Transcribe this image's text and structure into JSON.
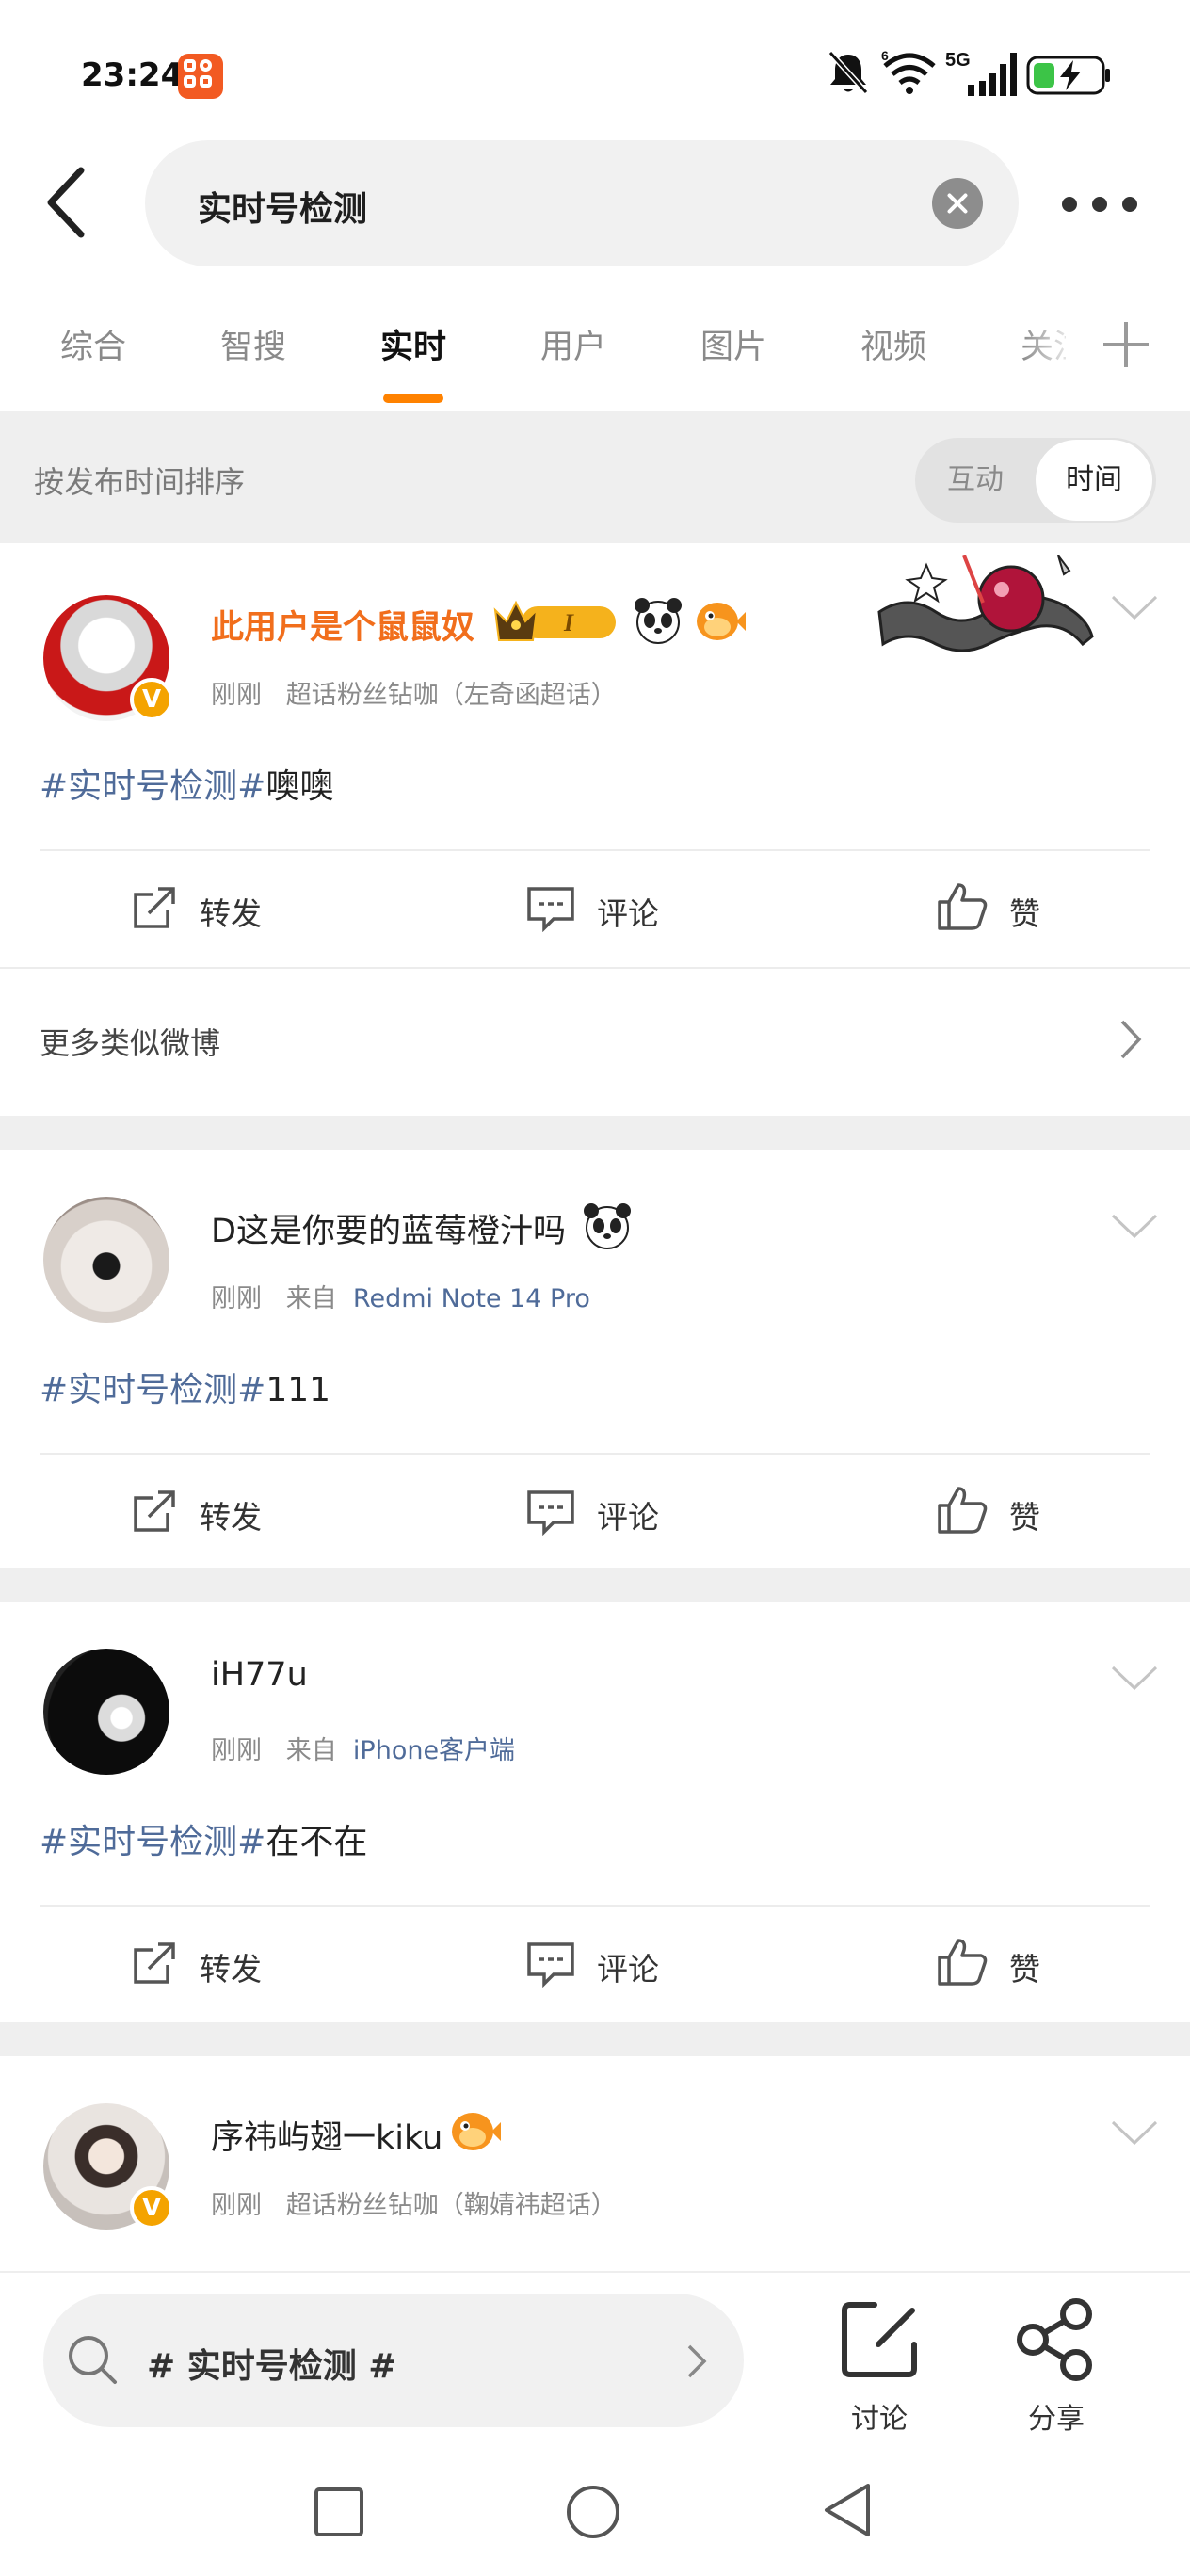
{
  "status_bar": {
    "time": "23:24",
    "icons": [
      "kuaishou-app-icon",
      "mute-bell-icon",
      "wifi-icon",
      "5g-signal-icon",
      "battery-charging-icon"
    ],
    "wifi_badge": "6",
    "network": "5G"
  },
  "header": {
    "search_query": "实时号检测",
    "back_icon": "back-arrow-icon",
    "clear_icon": "clear-icon",
    "more_icon": "more-dots-icon"
  },
  "tabs": [
    {
      "label": "综合",
      "active": false
    },
    {
      "label": "智搜",
      "active": false
    },
    {
      "label": "实时",
      "active": true
    },
    {
      "label": "用户",
      "active": false
    },
    {
      "label": "图片",
      "active": false
    },
    {
      "label": "视频",
      "active": false
    },
    {
      "label": "关注",
      "active": false
    }
  ],
  "accent_color": "#ff8200",
  "link_color": "#4f6b99",
  "sort": {
    "label": "按发布时间排序",
    "options": [
      "互动",
      "时间"
    ],
    "selected": "时间"
  },
  "posts": [
    {
      "username": "此用户是个鼠鼠奴",
      "vip_level": "I",
      "time": "刚刚",
      "source": "超话粉丝钻咖（左奇函超话）",
      "source_prefix": "",
      "hashtag": "#实时号检测#",
      "text": "噢噢",
      "verified": true
    },
    {
      "username": "D这是你要的蓝莓橙汁吗",
      "time": "刚刚",
      "source_prefix": "来自",
      "source": "Redmi Note 14 Pro",
      "hashtag": "#实时号检测#",
      "text": "111",
      "verified": false
    },
    {
      "username": "iH77u",
      "time": "刚刚",
      "source_prefix": "来自",
      "source": "iPhone客户端",
      "hashtag": "#实时号检测#",
      "text": "在不在",
      "verified": false
    },
    {
      "username": "序祎屿翅一kiku",
      "time": "刚刚",
      "source_prefix": "",
      "source": "超话粉丝钻咖（鞠婧祎超话）",
      "verified": true
    }
  ],
  "actions": {
    "repost": "转发",
    "comment": "评论",
    "like": "赞"
  },
  "more_similar": "更多类似微博",
  "bottom_bar": {
    "topic": "# 实时号检测 #",
    "discuss": "讨论",
    "share": "分享"
  }
}
